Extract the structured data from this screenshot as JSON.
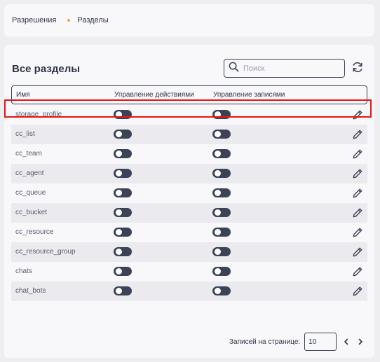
{
  "breadcrumb": {
    "items": [
      "Разрешения",
      "Разделы"
    ]
  },
  "page": {
    "title": "Все разделы"
  },
  "search": {
    "placeholder": "Поиск",
    "value": ""
  },
  "table": {
    "columns": [
      "Имя",
      "Управление действиями",
      "Управление записями"
    ],
    "rows": [
      {
        "name": "storage_profile",
        "actions_enabled": false,
        "records_enabled": false
      },
      {
        "name": "cc_list",
        "actions_enabled": false,
        "records_enabled": false
      },
      {
        "name": "cc_team",
        "actions_enabled": false,
        "records_enabled": false
      },
      {
        "name": "cc_agent",
        "actions_enabled": false,
        "records_enabled": false
      },
      {
        "name": "cc_queue",
        "actions_enabled": false,
        "records_enabled": false
      },
      {
        "name": "cc_bucket",
        "actions_enabled": false,
        "records_enabled": false
      },
      {
        "name": "cc_resource",
        "actions_enabled": false,
        "records_enabled": false
      },
      {
        "name": "cc_resource_group",
        "actions_enabled": false,
        "records_enabled": false
      },
      {
        "name": "chats",
        "actions_enabled": false,
        "records_enabled": false
      },
      {
        "name": "chat_bots",
        "actions_enabled": false,
        "records_enabled": false
      }
    ]
  },
  "pagination": {
    "label": "Записей на странице:",
    "per_page": "10"
  },
  "icons": {
    "search": "search-icon",
    "refresh": "refresh-icon",
    "edit": "pencil-icon",
    "prev": "chevron-left-icon",
    "next": "chevron-right-icon"
  },
  "colors": {
    "accent": "#f2a63b",
    "toggle_off": "#3d4356",
    "highlight": "#e81414"
  }
}
